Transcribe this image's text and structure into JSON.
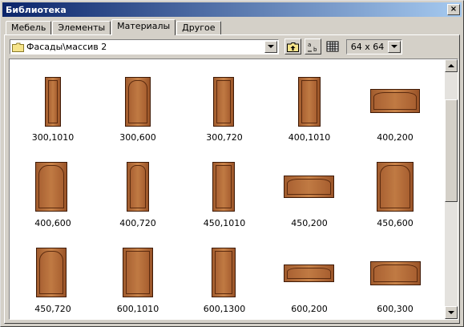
{
  "window": {
    "title": "Библиотека",
    "close_label": "×"
  },
  "tabs": [
    {
      "label": "Мебель"
    },
    {
      "label": "Элементы"
    },
    {
      "label": "Материалы",
      "active": true
    },
    {
      "label": "Другое"
    }
  ],
  "path": {
    "value": "Фасады\\массив 2"
  },
  "size": {
    "value": "64 x 64"
  },
  "icons": {
    "folder": "folder-icon",
    "up": "folder-up-icon",
    "sort": "sort-icon",
    "view": "grid-view-icon",
    "dropdown": "chevron-down-icon",
    "scroll_up": "arrow-up-icon",
    "scroll_down": "arrow-down-icon"
  },
  "items": [
    {
      "label": "300,1010"
    },
    {
      "label": "300,600"
    },
    {
      "label": "300,720"
    },
    {
      "label": "400,1010"
    },
    {
      "label": "400,200"
    },
    {
      "label": "400,600"
    },
    {
      "label": "400,720"
    },
    {
      "label": "450,1010"
    },
    {
      "label": "450,200"
    },
    {
      "label": "450,600"
    },
    {
      "label": "450,720"
    },
    {
      "label": "600,1010"
    },
    {
      "label": "600,1300"
    },
    {
      "label": "600,200"
    },
    {
      "label": "600,300"
    }
  ]
}
